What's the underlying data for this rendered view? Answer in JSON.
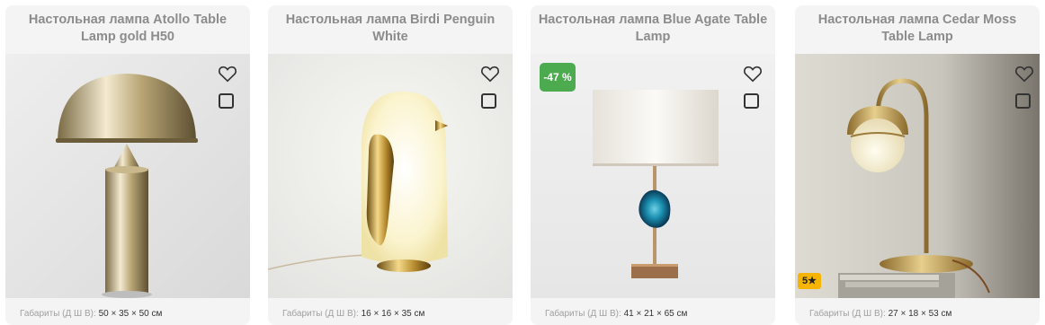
{
  "products": [
    {
      "title": "Настольная лампа Atollo Table Lamp gold H50",
      "dims_label": "Габариты (Д Ш В):",
      "dims_value": "50 × 35 × 50 см",
      "favorite_icon": "heart-icon",
      "compare_icon": "checkbox-icon"
    },
    {
      "title": "Настольная лампа Birdi Penguin White",
      "dims_label": "Габариты (Д Ш В):",
      "dims_value": "16 × 16 × 35 см",
      "favorite_icon": "heart-icon",
      "compare_icon": "checkbox-icon"
    },
    {
      "title": "Настольная лампа Blue Agate Table Lamp",
      "discount_badge": "-47 %",
      "dims_label": "Габариты (Д Ш В):",
      "dims_value": "41 × 21 × 65 см",
      "favorite_icon": "heart-icon",
      "compare_icon": "checkbox-icon"
    },
    {
      "title": "Настольная лампа Cedar Moss Table Lamp",
      "rating_badge": "5★",
      "dims_label": "Габариты (Д Ш В):",
      "dims_value": "27 × 18 × 53 см",
      "favorite_icon": "heart-icon",
      "compare_icon": "checkbox-icon"
    }
  ],
  "colors": {
    "discount_badge": "#4caa4f",
    "rating_badge": "#f5b400",
    "title_text": "#8c8c8c"
  }
}
